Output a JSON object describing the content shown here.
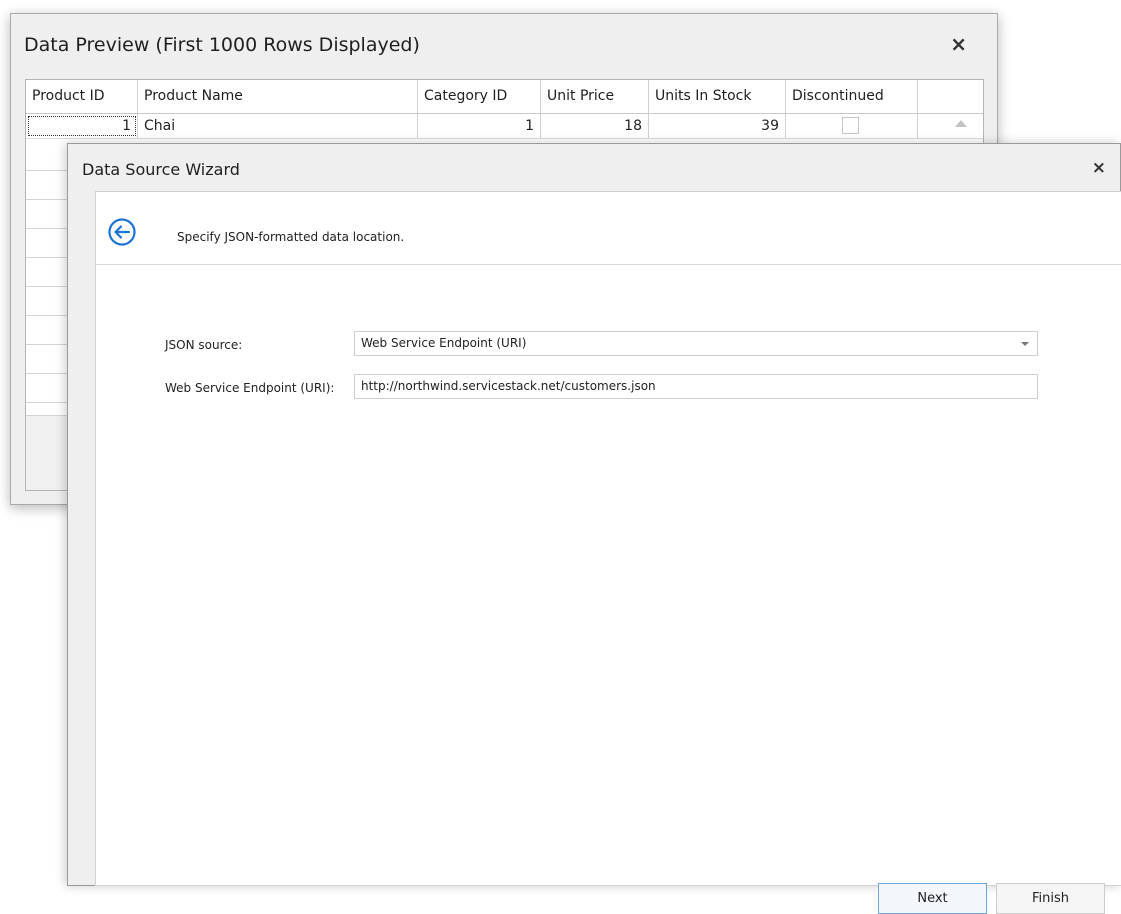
{
  "preview": {
    "title": "Data Preview (First 1000 Rows Displayed)",
    "close": "×",
    "columns": [
      "Product ID",
      "Product Name",
      "Category ID",
      "Unit Price",
      "Units In Stock",
      "Discontinued"
    ],
    "rows": [
      {
        "product_id": "1",
        "product_name": "Chai",
        "category_id": "1",
        "unit_price": "18",
        "units_in_stock": "39",
        "discontinued": false
      }
    ]
  },
  "wizard": {
    "title": "Data Source Wizard",
    "close": "×",
    "subtitle": "Specify JSON-formatted data location.",
    "json_source_label": "JSON source:",
    "json_source_value": "Web Service Endpoint (URI)",
    "endpoint_label": "Web Service Endpoint (URI):",
    "endpoint_value": "http://northwind.servicestack.net/customers.json",
    "next_label": "Next",
    "finish_label": "Finish"
  },
  "colors": {
    "accent": "#1e74d6"
  },
  "icons": {
    "back": "arrow-left-circle-icon",
    "scroll_up": "triangle-up-icon",
    "dropdown": "chevron-down-icon"
  }
}
